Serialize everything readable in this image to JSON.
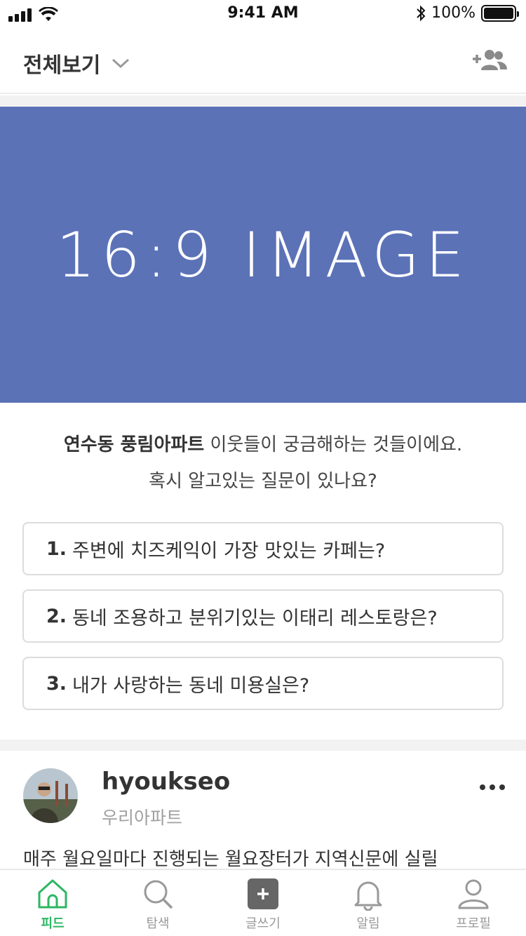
{
  "status_bar": {
    "time": "9:41 AM",
    "battery": "100%"
  },
  "header": {
    "title": "전체보기"
  },
  "hero": {
    "text": "16:9 IMAGE",
    "color": "#5b72b7"
  },
  "intro": {
    "place": "연수동 풍림아파트",
    "line1_rest": " 이웃들이 궁금해하는 것들이에요.",
    "line2": "혹시 알고있는 질문이 있나요?"
  },
  "questions": [
    {
      "num": "1.",
      "text": "주변에 치즈케익이 가장 맛있는 카페는?"
    },
    {
      "num": "2.",
      "text": "동네 조용하고 분위기있는 이태리 레스토랑은?"
    },
    {
      "num": "3.",
      "text": "내가 사랑하는 동네 미용실은?"
    }
  ],
  "post": {
    "username": "hyoukseo",
    "subtitle": "우리아파트",
    "body": "매주 월요일마다 진행되는 월요장터가 지역신문에 실릴"
  },
  "tabs": [
    {
      "label": "피드",
      "icon": "home-icon",
      "active": true
    },
    {
      "label": "탐색",
      "icon": "search-icon",
      "active": false
    },
    {
      "label": "글쓰기",
      "icon": "write-icon",
      "active": false
    },
    {
      "label": "알림",
      "icon": "bell-icon",
      "active": false
    },
    {
      "label": "프로필",
      "icon": "profile-icon",
      "active": false
    }
  ],
  "colors": {
    "accent": "#2db663",
    "hero": "#5b72b7"
  }
}
